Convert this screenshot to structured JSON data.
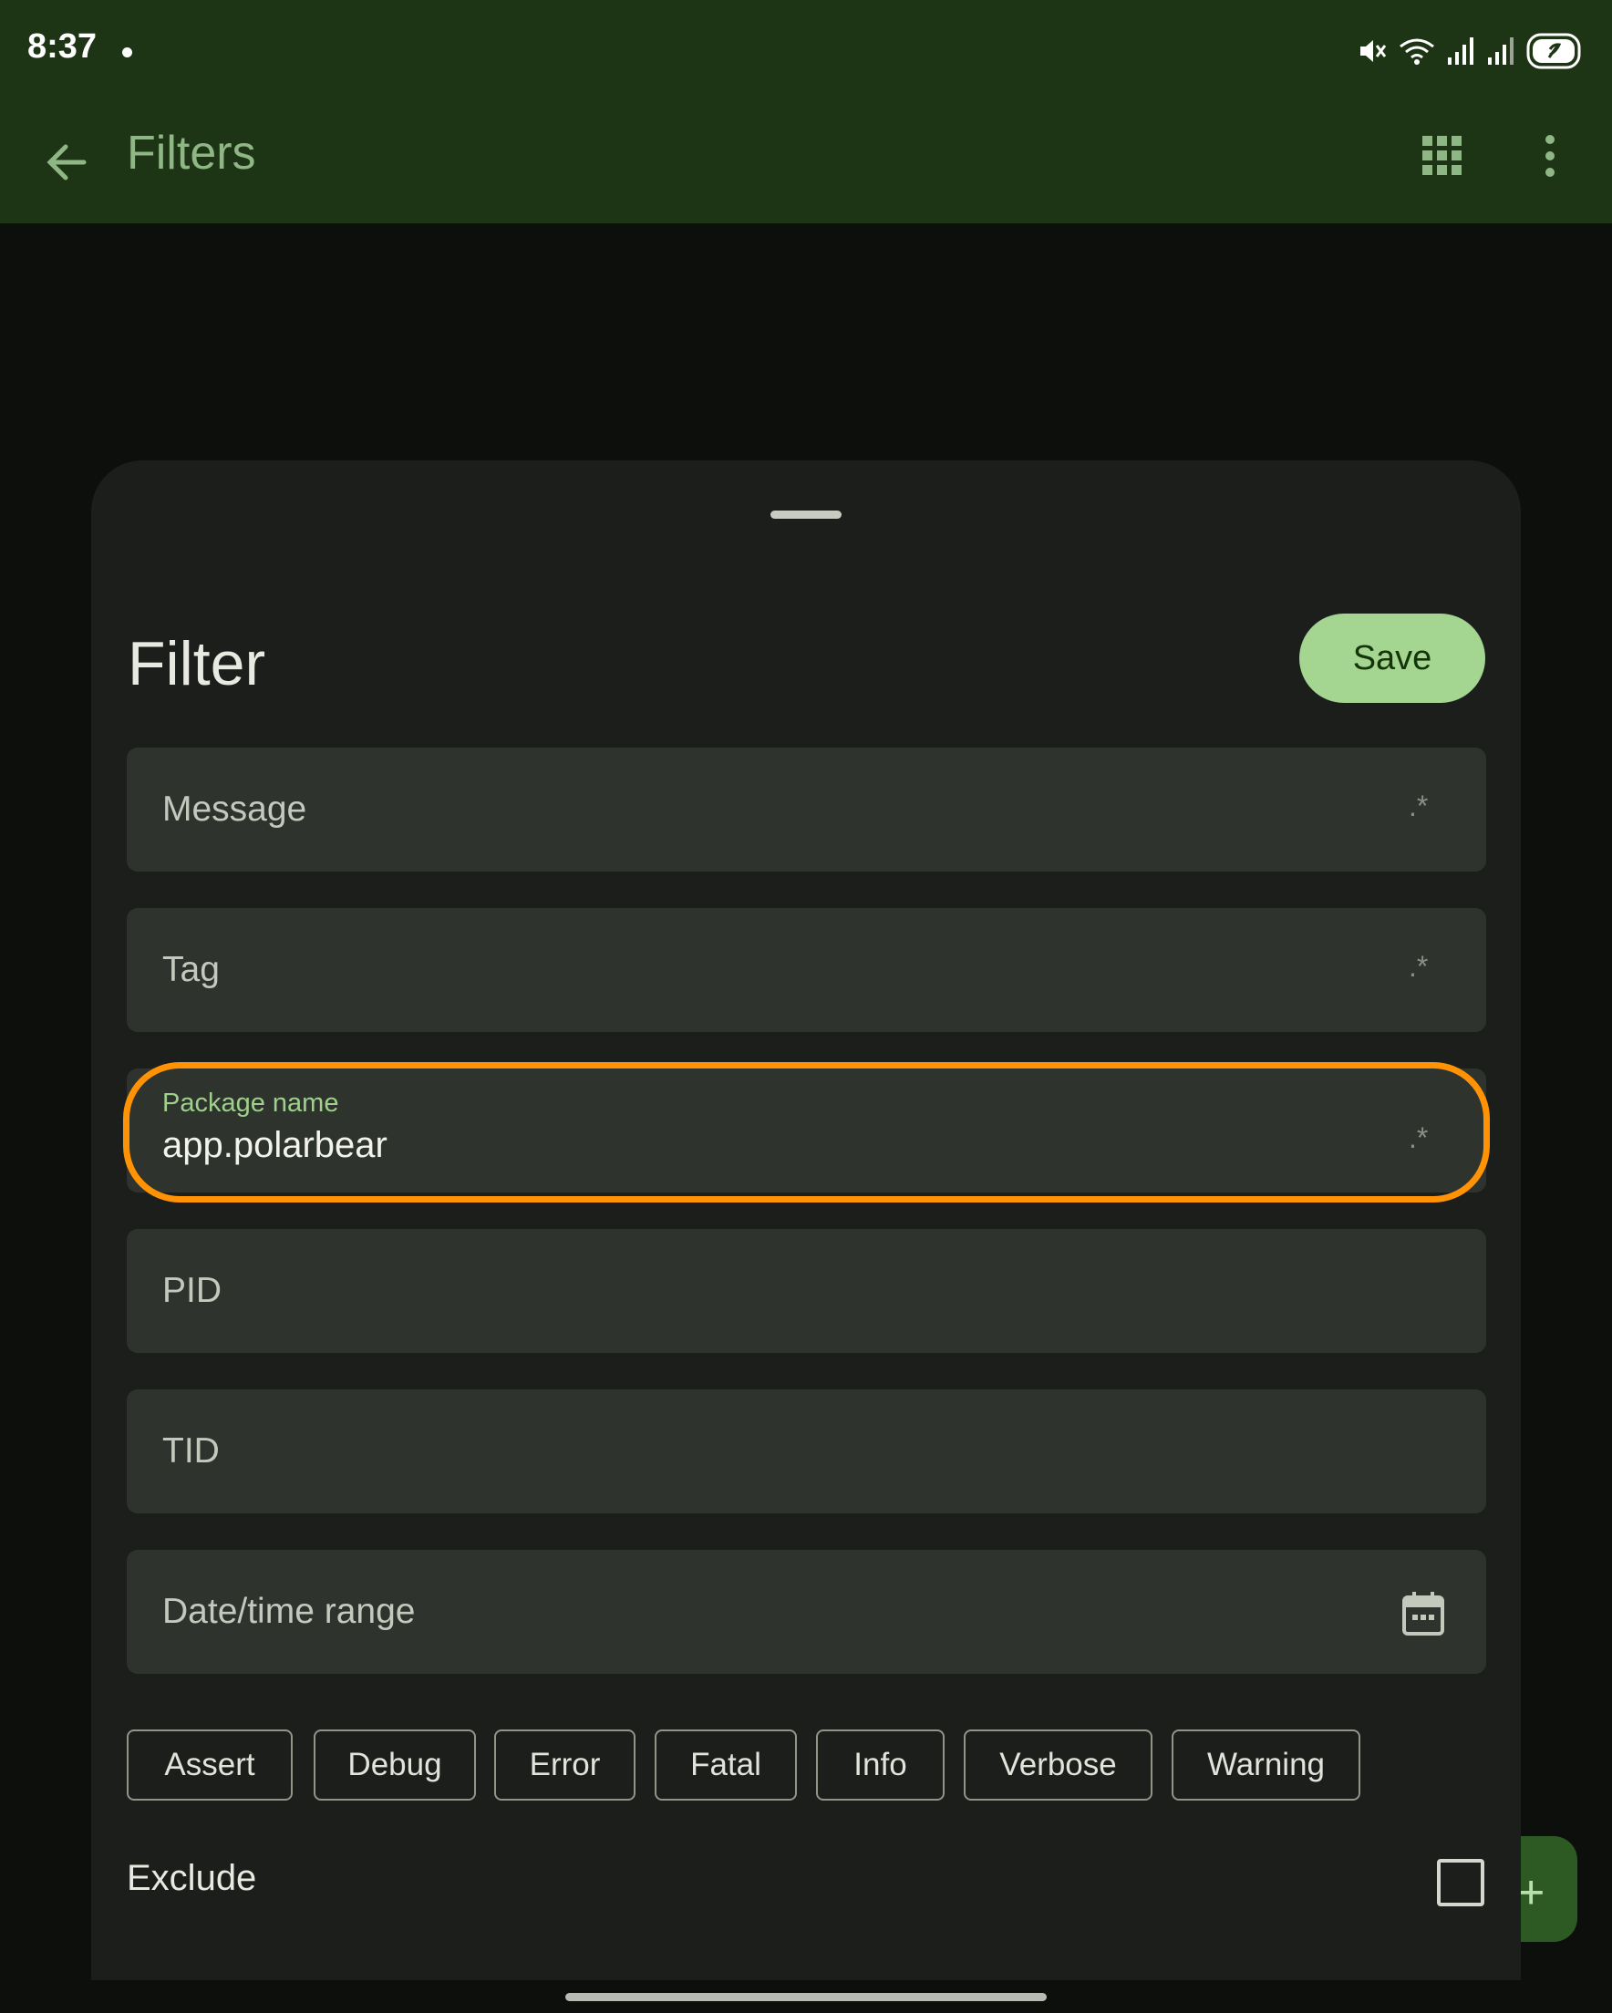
{
  "status_bar": {
    "time": "8:37"
  },
  "app_bar": {
    "title": "Filters"
  },
  "sheet": {
    "title": "Filter",
    "save_label": "Save",
    "fields": {
      "message": {
        "label": "Message",
        "suffix": ".*"
      },
      "tag": {
        "label": "Tag",
        "suffix": ".*"
      },
      "package": {
        "label": "Package name",
        "value": "app.polarbear",
        "suffix": ".*"
      },
      "pid": {
        "label": "PID"
      },
      "tid": {
        "label": "TID"
      },
      "date_range": {
        "label": "Date/time range"
      }
    },
    "log_levels": [
      "Assert",
      "Debug",
      "Error",
      "Fatal",
      "Info",
      "Verbose",
      "Warning"
    ],
    "exclude_label": "Exclude",
    "exclude_checked": false
  },
  "colors": {
    "app_bar_bg": "#1e3515",
    "save_bg": "#a4d591",
    "highlight": "#ff9305",
    "floating_label": "#9fd08b"
  },
  "icons": {
    "back": "arrow-left-icon",
    "grid": "grid-icon",
    "more": "more-vertical-icon",
    "calendar": "calendar-icon",
    "fab": "plus-icon"
  }
}
